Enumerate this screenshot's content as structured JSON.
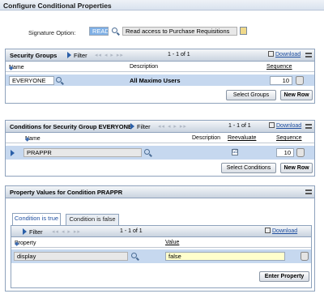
{
  "dialog": {
    "title": "Configure Conditional Properties"
  },
  "signature": {
    "label": "Signature Option:",
    "value": "READ",
    "description": "Read access to Purchase Requisitions"
  },
  "security_groups": {
    "title": "Security Groups",
    "filter_label": "Filter",
    "count": "1 - 1 of 1",
    "download_label": "Download",
    "columns": {
      "name": "Name",
      "description": "Description",
      "sequence": "Sequence"
    },
    "row": {
      "name": "EVERYONE",
      "description": "All Maximo Users",
      "sequence": "10"
    },
    "buttons": {
      "select": "Select Groups",
      "new_row": "New Row"
    }
  },
  "conditions": {
    "title": "Conditions for Security Group EVERYONE",
    "filter_label": "Filter",
    "count": "1 - 1 of 1",
    "download_label": "Download",
    "columns": {
      "name": "Name",
      "description": "Description",
      "reevaluate": "Reevaluate",
      "sequence": "Sequence"
    },
    "row": {
      "name": "PRAPPR",
      "reevaluate": "☑",
      "sequence": "10"
    },
    "buttons": {
      "select": "Select Conditions",
      "new_row": "New Row"
    }
  },
  "property_values": {
    "title": "Property Values for Condition PRAPPR",
    "tabs": [
      "Condition is true",
      "Condition is false"
    ],
    "filter_label": "Filter",
    "count": "1 - 1 of 1",
    "download_label": "Download",
    "columns": {
      "property": "Property",
      "value": "Value"
    },
    "row": {
      "property": "display",
      "value": "false"
    },
    "buttons": {
      "enter": "Enter Property"
    }
  },
  "icons": [
    "search-icon",
    "lookup-icon",
    "filter-icon",
    "download-icon",
    "menu-icon",
    "trash-icon",
    "sort-icon"
  ]
}
